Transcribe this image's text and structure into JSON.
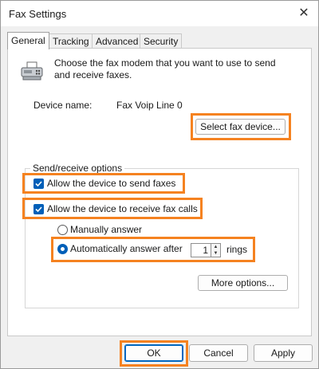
{
  "window": {
    "title": "Fax Settings",
    "close_glyph": "✕"
  },
  "tabs": [
    {
      "label": "General",
      "active": true
    },
    {
      "label": "Tracking",
      "active": false
    },
    {
      "label": "Advanced",
      "active": false
    },
    {
      "label": "Security",
      "active": false
    }
  ],
  "general": {
    "intro": "Choose the fax modem that you want to use to send and receive faxes.",
    "device_label": "Device name:",
    "device_value": "Fax Voip Line 0",
    "select_device_button": "Select fax device...",
    "group_title": "Send/receive options",
    "allow_send": {
      "label": "Allow the device to send faxes",
      "checked": true
    },
    "allow_receive": {
      "label": "Allow the device to receive fax calls",
      "checked": true
    },
    "manual_answer": {
      "label": "Manually answer",
      "selected": false
    },
    "auto_answer": {
      "label": "Automatically answer after",
      "selected": true,
      "rings_value": "1",
      "rings_suffix": "rings"
    },
    "more_options_button": "More options..."
  },
  "footer": {
    "ok": "OK",
    "cancel": "Cancel",
    "apply": "Apply"
  },
  "colors": {
    "highlight": "#f58220",
    "accent": "#005fb8"
  },
  "icons": {
    "title_close": "close-icon",
    "device": "fax-machine-icon",
    "checked": "checkmark-icon"
  }
}
